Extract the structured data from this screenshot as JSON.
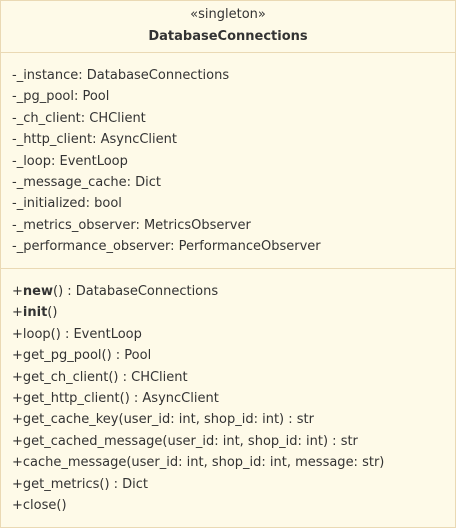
{
  "class": {
    "stereotype": "«singleton»",
    "name": "DatabaseConnections"
  },
  "attributes": [
    "-_instance: DatabaseConnections",
    "-_pg_pool: Pool",
    "-_ch_client: CHClient",
    "-_http_client: AsyncClient",
    "-_loop: EventLoop",
    "-_message_cache: Dict",
    "-_initialized: bool",
    "-_metrics_observer: MetricsObserver",
    "-_performance_observer: PerformanceObserver"
  ],
  "methods": {
    "new": {
      "prefix": "+",
      "name": "new",
      "rest": "() : DatabaseConnections"
    },
    "init": {
      "prefix": "+",
      "name": "init",
      "rest": "()"
    },
    "loop": "+loop() : EventLoop",
    "get_pg_pool": "+get_pg_pool() : Pool",
    "get_ch_client": "+get_ch_client() : CHClient",
    "get_http_client": "+get_http_client() : AsyncClient",
    "get_cache_key": "+get_cache_key(user_id: int, shop_id: int) : str",
    "get_cached_message": "+get_cached_message(user_id: int, shop_id: int) : str",
    "cache_message": "+cache_message(user_id: int, shop_id: int, message: str)",
    "get_metrics": "+get_metrics() : Dict",
    "close": "+close()"
  },
  "colors": {
    "fill": "#fefae8",
    "border": "#ead9b4",
    "text": "#333333"
  }
}
